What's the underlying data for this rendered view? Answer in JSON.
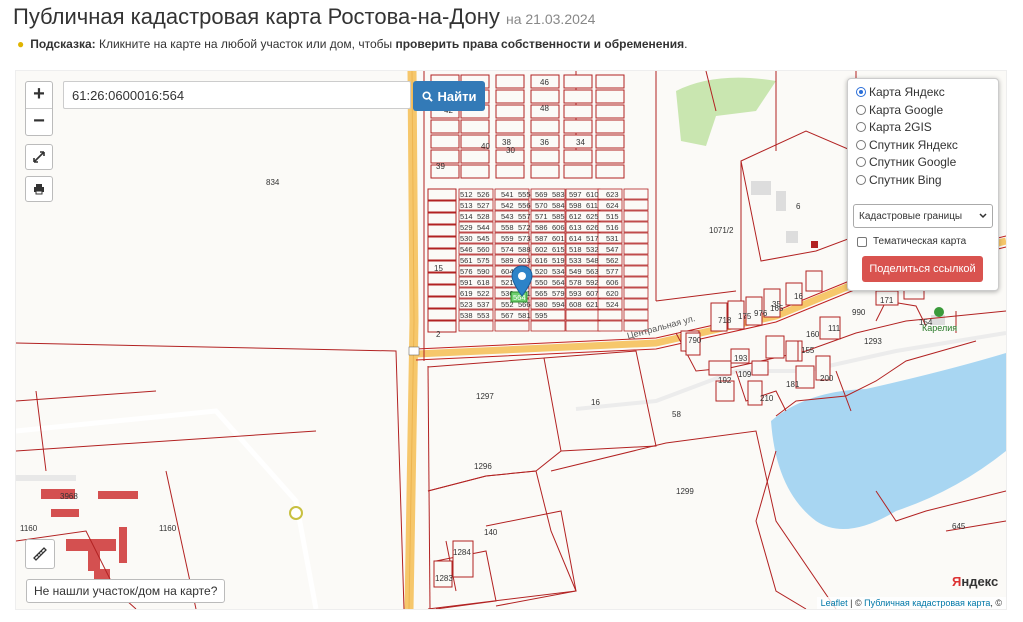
{
  "header": {
    "title": "Публичная кадастровая карта Ростова-на-Дону",
    "date": "на 21.03.2024"
  },
  "hint": {
    "label": "Подсказка:",
    "text": " Кликните на карте на любой участок или дом, чтобы ",
    "bold": "проверить права собственности и обременения",
    "end": "."
  },
  "map": {
    "zoom_in": "+",
    "zoom_out": "−",
    "search_value": "61:26:0600016:564",
    "find_button": "Найти",
    "layers": [
      {
        "label": "Карта Яндекс",
        "selected": true
      },
      {
        "label": "Карта Google",
        "selected": false
      },
      {
        "label": "Карта 2GIS",
        "selected": false
      },
      {
        "label": "Спутник Яндекс",
        "selected": false
      },
      {
        "label": "Спутник Google",
        "selected": false
      },
      {
        "label": "Спутник Bing",
        "selected": false
      }
    ],
    "overlay_select": "Кадастровые границы",
    "thematic_label": "Тематическая карта",
    "thematic_checked": false,
    "share_button": "Поделиться ссылкой",
    "not_found_button": "Не нашли участок/дом на карте?",
    "attribution_leaflet": "Leaflet",
    "attribution_sep": " | © ",
    "attribution_link": "Публичная кадастровая карта",
    "attribution_end": ", ©",
    "yandex_logo_first": "Я",
    "yandex_logo_rest": "ндекс",
    "street_label": "Центральная ул.",
    "poi_name": "Карелия",
    "selected_parcel": "564",
    "parcel_labels": [
      "834",
      "1071/2",
      "6",
      "1297",
      "16",
      "1296",
      "1299",
      "140",
      "1160",
      "1160",
      "3968",
      "645",
      "1293",
      "154",
      "990",
      "171",
      "1283",
      "1284",
      "790",
      "718",
      "175",
      "976",
      "165",
      "193",
      "109",
      "192",
      "155",
      "160",
      "181",
      "200",
      "210",
      "111",
      "35",
      "16",
      "15",
      "2",
      "58",
      "42",
      "44",
      "46",
      "48",
      "40",
      "38",
      "30",
      "36",
      "34",
      "39"
    ],
    "grid_labels": [
      "512",
      "526",
      "541",
      "555",
      "569",
      "583",
      "597",
      "610",
      "623",
      "513",
      "527",
      "542",
      "556",
      "570",
      "584",
      "598",
      "611",
      "624",
      "514",
      "528",
      "543",
      "557",
      "571",
      "585",
      "612",
      "625",
      "515",
      "529",
      "544",
      "558",
      "572",
      "586",
      "606",
      "613",
      "626",
      "516",
      "530",
      "545",
      "559",
      "573",
      "587",
      "601",
      "614",
      "517",
      "531",
      "546",
      "560",
      "574",
      "588",
      "602",
      "615",
      "518",
      "532",
      "547",
      "561",
      "575",
      "589",
      "603",
      "616",
      "519",
      "533",
      "548",
      "562",
      "576",
      "590",
      "604",
      "617",
      "520",
      "534",
      "549",
      "563",
      "577",
      "591",
      "618",
      "521",
      "535",
      "550",
      "564",
      "578",
      "592",
      "606",
      "619",
      "522",
      "536",
      "551",
      "565",
      "579",
      "593",
      "607",
      "620",
      "523",
      "537",
      "552",
      "566",
      "580",
      "594",
      "608",
      "621",
      "524",
      "538",
      "553",
      "567",
      "581",
      "595"
    ]
  }
}
